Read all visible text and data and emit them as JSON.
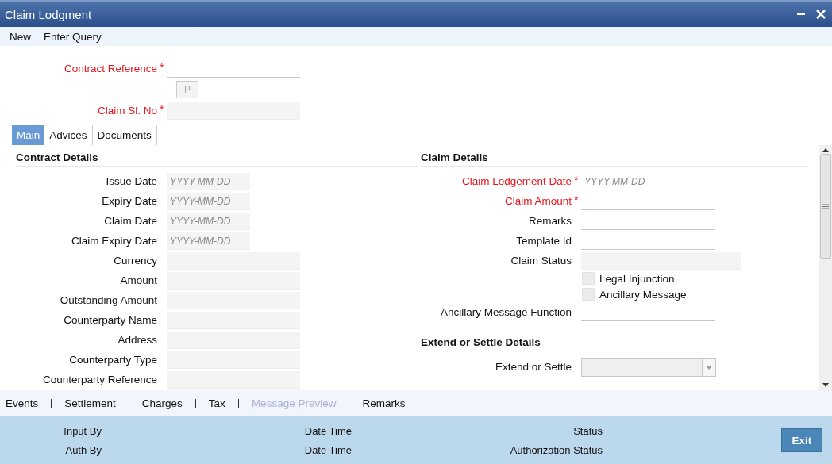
{
  "window": {
    "title": "Claim Lodgment"
  },
  "toolbar": [
    "New",
    "Enter Query"
  ],
  "required_marker": "*",
  "header_fields": [
    {
      "kind": "input",
      "label": "Contract Reference",
      "required": true
    },
    {
      "kind": "button",
      "label": "P",
      "disabled": true
    },
    {
      "kind": "readonly",
      "label": "Claim Sl. No",
      "required": true
    }
  ],
  "tabs": [
    {
      "label": "Main",
      "selected": true
    },
    {
      "label": "Advices",
      "selected": false
    },
    {
      "label": "Documents",
      "selected": false
    }
  ],
  "columns": [
    [
      {
        "title": "Contract Details",
        "fields": [
          {
            "kind": "date",
            "label": "Issue Date",
            "required": false,
            "placeholder": "YYYY-MM-DD"
          },
          {
            "kind": "date",
            "label": "Expiry Date",
            "required": false,
            "placeholder": "YYYY-MM-DD"
          },
          {
            "kind": "date",
            "label": "Claim Date",
            "required": false,
            "placeholder": "YYYY-MM-DD"
          },
          {
            "kind": "date",
            "label": "Claim Expiry Date",
            "required": false,
            "placeholder": "YYYY-MM-DD"
          },
          {
            "kind": "readonly",
            "label": "Currency",
            "required": false
          },
          {
            "kind": "readonly",
            "label": "Amount",
            "required": false
          },
          {
            "kind": "readonly",
            "label": "Outstanding Amount",
            "required": false
          },
          {
            "kind": "readonly",
            "label": "Counterparty Name",
            "required": false
          },
          {
            "kind": "readonly",
            "label": "Address",
            "required": false
          },
          {
            "kind": "readonly",
            "label": "Counterparty Type",
            "required": false
          },
          {
            "kind": "readonly",
            "label": "Counterparty Reference",
            "required": false
          }
        ]
      }
    ],
    [
      {
        "title": "Claim Details",
        "fields": [
          {
            "kind": "dateinput",
            "label": "Claim Lodgement Date",
            "required": true,
            "placeholder": "YYYY-MM-DD"
          },
          {
            "kind": "input",
            "label": "Claim Amount",
            "required": true
          },
          {
            "kind": "input",
            "label": "Remarks",
            "required": false
          },
          {
            "kind": "input",
            "label": "Template Id",
            "required": false
          },
          {
            "kind": "readonlywide",
            "label": "Claim Status",
            "required": false
          },
          {
            "kind": "checkbox",
            "label": "Legal Injunction",
            "checked": false
          },
          {
            "kind": "checkbox",
            "label": "Ancillary Message",
            "checked": false
          },
          {
            "kind": "input",
            "label": "Ancillary Message Function",
            "required": false
          }
        ]
      },
      {
        "title": "Extend or Settle Details",
        "fields": [
          {
            "kind": "select",
            "label": "Extend or Settle",
            "required": false
          }
        ]
      }
    ]
  ],
  "footer_links": [
    {
      "label": "Events",
      "disabled": false
    },
    {
      "label": "Settlement",
      "disabled": false
    },
    {
      "label": "Charges",
      "disabled": false
    },
    {
      "label": "Tax",
      "disabled": false
    },
    {
      "label": "Message Preview",
      "disabled": true
    },
    {
      "label": "Remarks",
      "disabled": false
    }
  ],
  "audit": [
    {
      "label": "Input By"
    },
    {
      "label": "Date Time"
    },
    {
      "label": "Status"
    },
    {
      "label": "Auth By"
    },
    {
      "label": "Date Time"
    },
    {
      "label": "Authorization Status"
    }
  ],
  "exit_button": "Exit"
}
